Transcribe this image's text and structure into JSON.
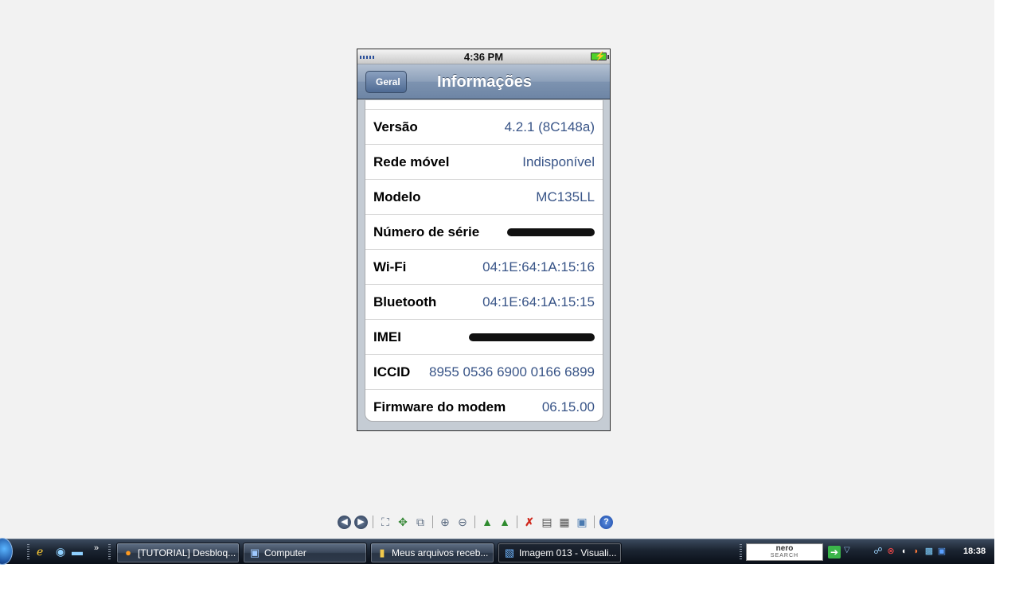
{
  "phone": {
    "status_time": "4:36 PM",
    "nav_back_label": "Geral",
    "nav_title": "Informações",
    "rows": [
      {
        "label": "Versão",
        "value": "4.2.1 (8C148a)"
      },
      {
        "label": "Rede móvel",
        "value": "Indisponível"
      },
      {
        "label": "Modelo",
        "value": "MC135LL"
      },
      {
        "label": "Número de série",
        "value": ""
      },
      {
        "label": "Wi-Fi",
        "value": "04:1E:64:1A:15:16"
      },
      {
        "label": "Bluetooth",
        "value": "04:1E:64:1A:15:15"
      },
      {
        "label": "IMEI",
        "value": ""
      },
      {
        "label": "ICCID",
        "value": "8955 0536 6900 0166 6899"
      },
      {
        "label": "Firmware do modem",
        "value": "06.15.00"
      }
    ]
  },
  "toolbar": {
    "icons": [
      "back-icon",
      "forward-icon",
      "fit-window-icon",
      "actual-size-icon",
      "slideshow-icon",
      "zoom-in-icon",
      "zoom-out-icon",
      "rotate-left-icon",
      "rotate-right-icon",
      "delete-icon",
      "print-icon",
      "save-icon",
      "open-with-icon",
      "help-icon"
    ]
  },
  "taskbar": {
    "tasks": [
      {
        "label": "[TUTORIAL] Desbloq..."
      },
      {
        "label": "Computer"
      },
      {
        "label": "Meus arquivos receb..."
      },
      {
        "label": "Imagem 013 - Visuali..."
      }
    ],
    "search_brand": "nero",
    "search_sub": "SEARCH",
    "clock": "18:38"
  }
}
